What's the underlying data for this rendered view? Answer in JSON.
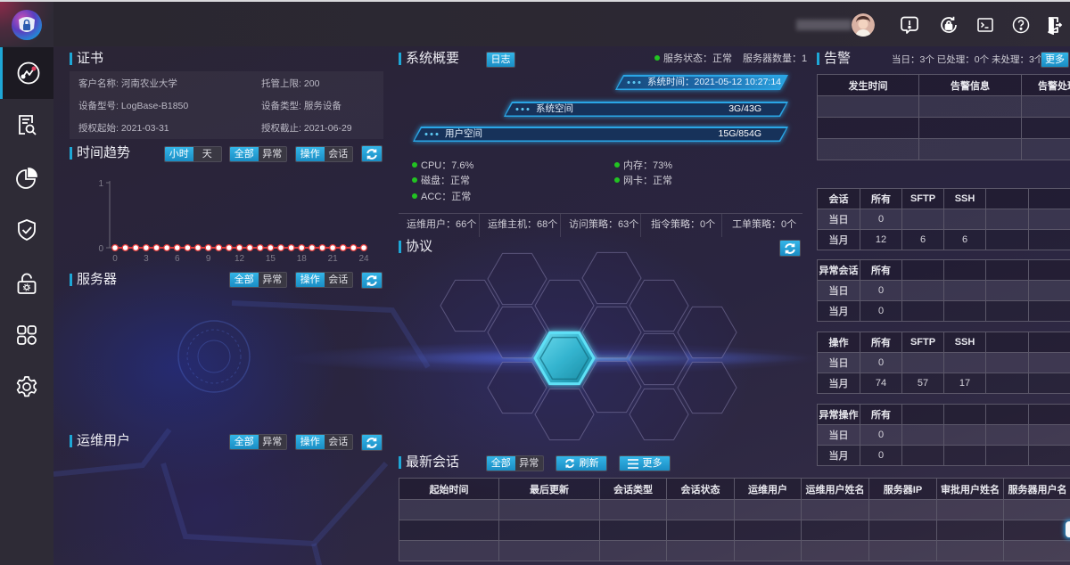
{
  "colors": {
    "accent": "#1ea7d6",
    "status_ok": "#22c322",
    "trend_line": "#e23b3b",
    "background": "#2a2636"
  },
  "sidebar": {
    "logo": "shield-lock-logo",
    "items": [
      {
        "id": "dashboard",
        "icon": "trend-chart-icon",
        "active": true
      },
      {
        "id": "audit",
        "icon": "report-search-icon",
        "active": false
      },
      {
        "id": "statistics",
        "icon": "pie-chart-icon",
        "active": false
      },
      {
        "id": "security",
        "icon": "shield-check-icon",
        "active": false
      },
      {
        "id": "access",
        "icon": "lock-gear-icon",
        "active": false
      },
      {
        "id": "apps",
        "icon": "apps-grid-icon",
        "active": false
      },
      {
        "id": "settings",
        "icon": "gear-icon",
        "active": false
      }
    ]
  },
  "topbar": {
    "user": {
      "avatar": "user-avatar",
      "name_blurred": true
    },
    "actions": [
      "alert-bubble-icon",
      "lock-rotate-icon",
      "terminal-icon",
      "help-icon",
      "logout-icon"
    ]
  },
  "certificate": {
    "title": "证书",
    "fields": [
      {
        "label": "客户名称:",
        "value": "河南农业大学"
      },
      {
        "label": "托管上限:",
        "value": "200"
      },
      {
        "label": "设备型号:",
        "value": "LogBase-B1850"
      },
      {
        "label": "设备类型:",
        "value": "服务设备"
      },
      {
        "label": "授权起始:",
        "value": "2021-03-31"
      },
      {
        "label": "授权截止:",
        "value": "2021-06-29"
      }
    ]
  },
  "time_trend": {
    "title": "时间趋势",
    "toggles": [
      {
        "options": [
          "小时",
          "天"
        ],
        "selected": 0
      },
      {
        "options": [
          "全部",
          "异常"
        ],
        "selected": 0
      },
      {
        "options": [
          "操作",
          "会话"
        ],
        "selected": 0
      }
    ]
  },
  "chart_data": {
    "type": "line",
    "title": "时间趋势",
    "xlabel": "",
    "ylabel": "",
    "x": [
      0,
      1,
      2,
      3,
      4,
      5,
      6,
      7,
      8,
      9,
      10,
      11,
      12,
      13,
      14,
      15,
      16,
      17,
      18,
      19,
      20,
      21,
      22,
      23,
      24
    ],
    "values": [
      0,
      0,
      0,
      0,
      0,
      0,
      0,
      0,
      0,
      0,
      0,
      0,
      0,
      0,
      0,
      0,
      0,
      0,
      0,
      0,
      0,
      0,
      0,
      0,
      0
    ],
    "xticks": [
      0,
      3,
      6,
      9,
      12,
      15,
      18,
      21,
      24
    ],
    "yticks": [
      0,
      1
    ],
    "xlim": [
      0,
      24
    ],
    "ylim": [
      0,
      1
    ],
    "grid": false,
    "legend": "none"
  },
  "servers": {
    "title": "服务器",
    "toggles": [
      {
        "options": [
          "全部",
          "异常"
        ],
        "selected": 0
      },
      {
        "options": [
          "操作",
          "会话"
        ],
        "selected": 0
      }
    ]
  },
  "ops_users": {
    "title": "运维用户",
    "toggles": [
      {
        "options": [
          "全部",
          "异常"
        ],
        "selected": 0
      },
      {
        "options": [
          "操作",
          "会话"
        ],
        "selected": 0
      }
    ]
  },
  "overview": {
    "title": "系统概要",
    "log_button": "日志",
    "service_status": {
      "label": "服务状态：",
      "value": "正常"
    },
    "server_count": {
      "label": "服务器数量：",
      "value": "1"
    },
    "system_time": {
      "label": "系统时间：",
      "value": "2021-05-12 10:27:14"
    },
    "system_space": {
      "label": "系统空间",
      "value": "3G/43G"
    },
    "user_space": {
      "label": "用户空间",
      "value": "15G/854G"
    },
    "health": [
      {
        "label": "CPU：",
        "value": "7.6%",
        "status": "ok"
      },
      {
        "label": "内存：",
        "value": "73%",
        "status": "ok"
      },
      {
        "label": "磁盘：",
        "value": "正常",
        "status": "ok"
      },
      {
        "label": "网卡：",
        "value": "正常",
        "status": "ok"
      },
      {
        "label": "ACC：",
        "value": "正常",
        "status": "ok"
      }
    ],
    "counts": [
      {
        "label": "运维用户：",
        "value": "66个"
      },
      {
        "label": "运维主机：",
        "value": "68个"
      },
      {
        "label": "访问策略：",
        "value": "63个"
      },
      {
        "label": "指令策略：",
        "value": "0个"
      },
      {
        "label": "工单策略：",
        "value": "0个"
      }
    ]
  },
  "protocol": {
    "title": "协议"
  },
  "latest_sessions": {
    "title": "最新会话",
    "toggle": {
      "options": [
        "全部",
        "异常"
      ],
      "selected": 0
    },
    "refresh_button": "刷新",
    "more_button": "更多",
    "table": {
      "headers": [
        "起始时间",
        "最后更新",
        "会话类型",
        "会话状态",
        "运维用户",
        "运维用户姓名",
        "服务器IP",
        "审批用户姓名",
        "服务器用户名"
      ],
      "rows": [
        [
          "",
          "",
          "",
          "",
          "",
          "",
          "",
          "",
          ""
        ],
        [
          "",
          "",
          "",
          "",
          "",
          "",
          "",
          "",
          ""
        ],
        [
          "",
          "",
          "",
          "",
          "",
          "",
          "",
          "",
          ""
        ]
      ]
    }
  },
  "alarms": {
    "title": "告警",
    "today": "当日：3个",
    "handled": "已处理：0个",
    "unhandled": "未处理：3个",
    "more_button": "更多",
    "table": {
      "headers": [
        "发生时间",
        "告警信息",
        "告警处理"
      ],
      "rows": [
        [
          "",
          "",
          ""
        ],
        [
          "",
          "",
          ""
        ],
        [
          "",
          "",
          ""
        ]
      ]
    }
  },
  "stats_tables": [
    {
      "headers": [
        "会话",
        "所有",
        "SFTP",
        "SSH",
        "",
        ""
      ],
      "rows": [
        [
          "当日",
          "0",
          "",
          "",
          "",
          ""
        ],
        [
          "当月",
          "12",
          "6",
          "6",
          "",
          ""
        ]
      ]
    },
    {
      "headers": [
        "异常会话",
        "所有",
        "",
        "",
        "",
        ""
      ],
      "rows": [
        [
          "当日",
          "0",
          "",
          "",
          "",
          ""
        ],
        [
          "当月",
          "0",
          "",
          "",
          "",
          ""
        ]
      ]
    },
    {
      "headers": [
        "操作",
        "所有",
        "SFTP",
        "SSH",
        "",
        ""
      ],
      "rows": [
        [
          "当日",
          "0",
          "",
          "",
          "",
          ""
        ],
        [
          "当月",
          "74",
          "57",
          "17",
          "",
          ""
        ]
      ]
    },
    {
      "headers": [
        "异常操作",
        "所有",
        "",
        "",
        "",
        ""
      ],
      "rows": [
        [
          "当日",
          "0",
          "",
          "",
          "",
          ""
        ],
        [
          "当月",
          "0",
          "",
          "",
          "",
          ""
        ]
      ]
    }
  ]
}
